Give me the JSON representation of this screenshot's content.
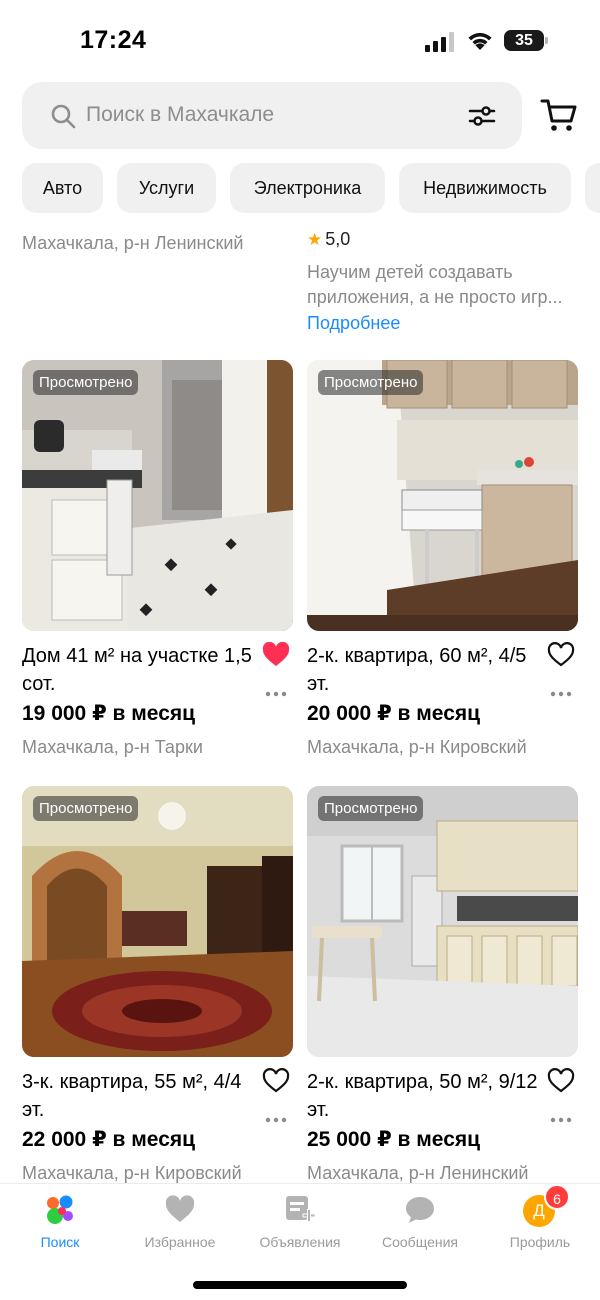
{
  "status": {
    "time": "17:24",
    "battery": "35"
  },
  "search": {
    "placeholder": "Поиск в Махачкале"
  },
  "chips": [
    "Авто",
    "Услуги",
    "Электроника",
    "Недвижимость"
  ],
  "partial_row": {
    "left_location": "Махачкала, р-н Ленинский",
    "rating": "5,0",
    "description": "Научим детей создавать приложения, а не просто игр...",
    "more_link": "Подробнее"
  },
  "listings": [
    {
      "badge": "Просмотрено",
      "title": "Дом 41 м² на участке 1,5 сот.",
      "price": "19 000 ₽ в месяц",
      "location": "Махачкала, р-н Тарки",
      "favorited": true,
      "photo": "kitchen-hall"
    },
    {
      "badge": "Просмотрено",
      "title": "2-к. квартира, 60 м², 4/5 эт.",
      "price": "20 000 ₽ в месяц",
      "location": "Махачкала, р-н Кировский",
      "favorited": false,
      "photo": "kitchen-stove"
    },
    {
      "badge": "Просмотрено",
      "title": "3-к. квартира, 55 м², 4/4 эт.",
      "price": "22 000 ₽ в месяц",
      "location": "Махачкала, р-н Кировский",
      "favorited": false,
      "photo": "living-room"
    },
    {
      "badge": "Просмотрено",
      "title": "2-к. квартира, 50 м², 9/12 эт.",
      "price": "25 000 ₽ в месяц",
      "location": "Махачкала, р-н Ленинский",
      "favorited": false,
      "photo": "kitchen-white"
    }
  ],
  "tabs": [
    {
      "label": "Поиск",
      "icon": "search-tab-icon",
      "active": true
    },
    {
      "label": "Избранное",
      "icon": "heart-icon",
      "active": false
    },
    {
      "label": "Объявления",
      "icon": "listing-add-icon",
      "active": false
    },
    {
      "label": "Сообщения",
      "icon": "chat-bubble-icon",
      "active": false
    },
    {
      "label": "Профиль",
      "icon": "avatar",
      "active": false
    }
  ],
  "profile": {
    "avatar_letter": "Д",
    "notifications": "6"
  },
  "colors": {
    "accent": "#1a8cff",
    "favorite": "#ff2e55",
    "rating_star": "#ffa500",
    "chip_bg": "#f0f0f0"
  }
}
